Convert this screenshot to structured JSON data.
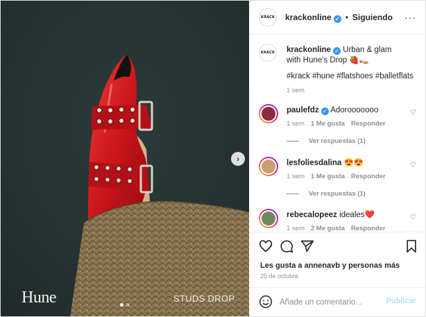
{
  "media": {
    "brand": "Hune",
    "caption_overlay": "STUDS DROP",
    "slide_index": 1,
    "slide_count": 2
  },
  "header": {
    "avatar_text": "KRACK",
    "username": "krackonline",
    "separator": "•",
    "follow_status": "Siguiendo",
    "more": "···"
  },
  "caption": {
    "avatar_text": "KRACK",
    "username": "krackonline",
    "text": "Urban & glam with Hune's Drop 🍓👡",
    "hashtags": "#krack #hune #flatshoes #balletflats",
    "time": "1 sem"
  },
  "comments": [
    {
      "username": "paulefdz",
      "verified": true,
      "text": "Adorooooooo",
      "time": "1 sem",
      "likes": "1 Me gusta",
      "reply": "Responder",
      "view_replies": "Ver respuestas (1)",
      "avatar_color": "#8a2c3a"
    },
    {
      "username": "lesfoliesdalina",
      "verified": false,
      "text": "😍😍",
      "time": "1 sem",
      "likes": "1 Me gusta",
      "reply": "Responder",
      "view_replies": "Ver respuestas (1)",
      "avatar_color": "#c9a070"
    },
    {
      "username": "rebecalopeez",
      "verified": false,
      "text": "ideales❤️",
      "time": "1 sem",
      "likes": "2 Me gusta",
      "reply": "Responder",
      "avatar_color": "#6f8a5a"
    }
  ],
  "actions": {
    "likes_text_prefix": "Les gusta a ",
    "likes_user": "annenavb",
    "likes_text_suffix": " y personas más",
    "date": "25 de octubre"
  },
  "composer": {
    "placeholder": "Añade un comentario...",
    "post_label": "Publicar"
  },
  "colors": {
    "shoe_red": "#d11a1f",
    "background": "#263433",
    "skirt": "#8a7452",
    "link": "#00376b",
    "verified": "#3897f0"
  }
}
